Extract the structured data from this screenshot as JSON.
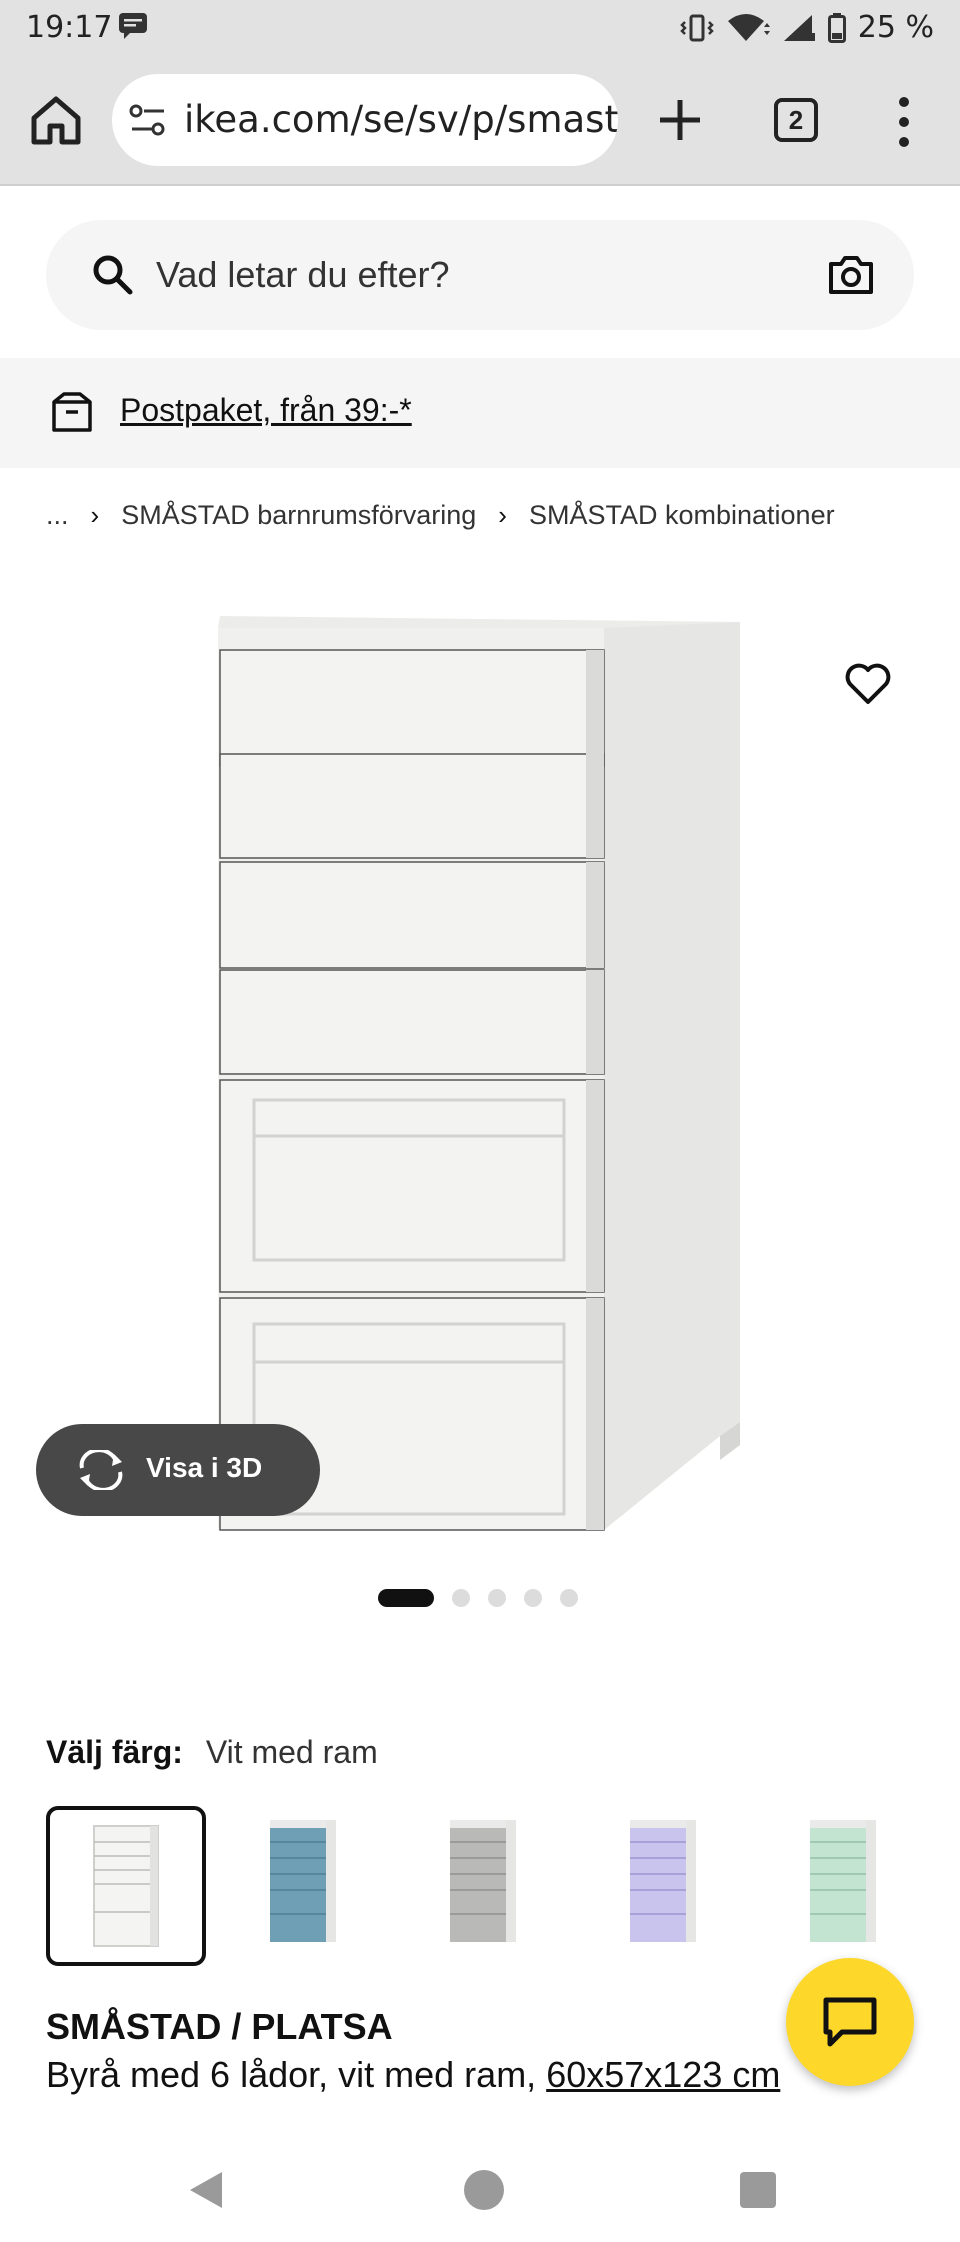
{
  "status_bar": {
    "time": "19:17",
    "battery": "25 %",
    "icons": [
      "message-icon",
      "vibrate-icon",
      "wifi-icon",
      "signal-icon",
      "battery-icon"
    ]
  },
  "browser": {
    "url": "ikea.com/se/sv/p/smastad",
    "tab_count": "2",
    "icons": [
      "home-icon",
      "site-settings-icon",
      "new-tab-icon",
      "tabs-icon",
      "more-menu-icon"
    ]
  },
  "search": {
    "placeholder": "Vad letar du efter?",
    "icons": [
      "search-icon",
      "camera-icon"
    ]
  },
  "delivery_banner": {
    "label": "Postpaket, från 39:-*",
    "icon": "package-icon"
  },
  "breadcrumb": {
    "items": [
      "...",
      "SMÅSTAD barnrumsförvaring",
      "SMÅSTAD kombinationer"
    ]
  },
  "gallery": {
    "view_3d_label": "Visa i 3D",
    "image_count": 5,
    "active_index": 0
  },
  "color_picker": {
    "label": "Välj färg:",
    "selected": "Vit med ram",
    "options": [
      {
        "name": "white",
        "color": "#f4f4f2"
      },
      {
        "name": "blue",
        "color": "#6f9fb4"
      },
      {
        "name": "grey",
        "color": "#b9b9b7"
      },
      {
        "name": "lilac",
        "color": "#c8c4ee"
      },
      {
        "name": "mint",
        "color": "#c4e4d2"
      }
    ]
  },
  "product": {
    "name": "SMÅSTAD / PLATSA",
    "description": "Byrå med 6 lådor, vit med ram, ",
    "dimensions": "60x57x123 cm"
  },
  "colors": {
    "accent": "#fdd82b",
    "pill": "#484848"
  }
}
